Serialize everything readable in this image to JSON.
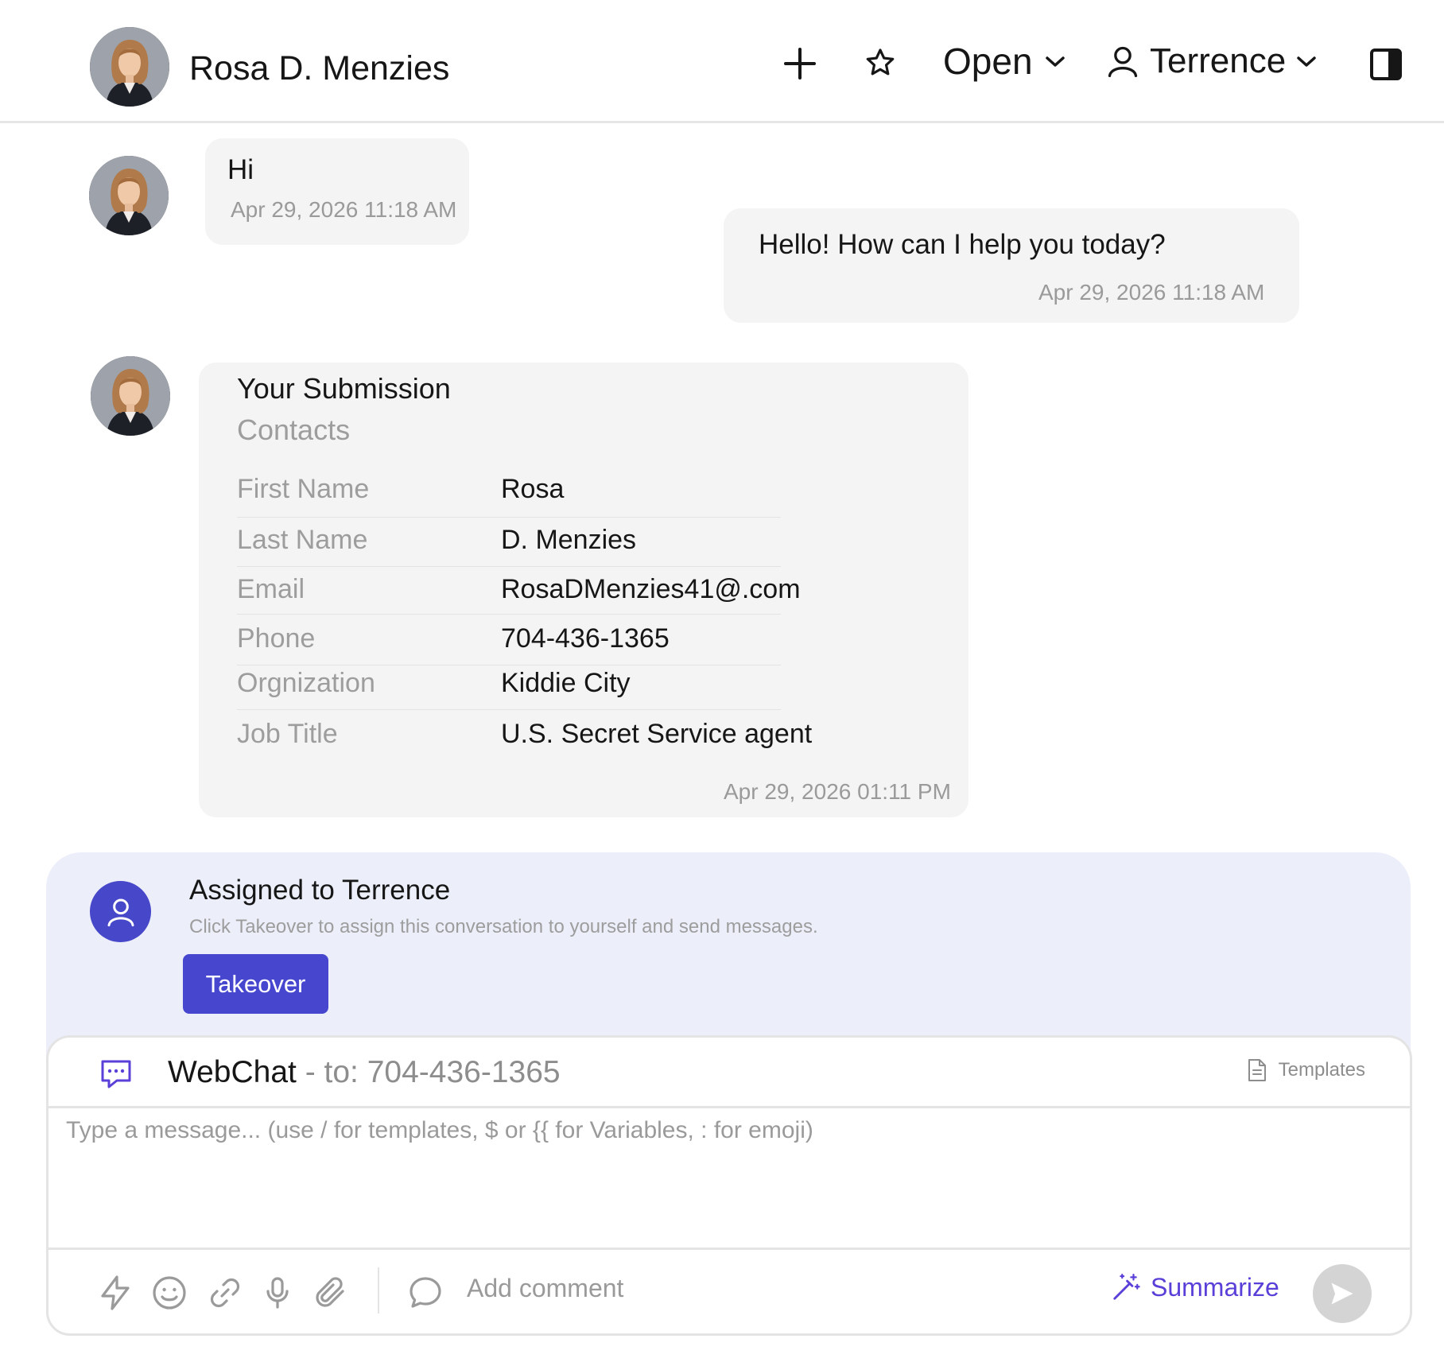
{
  "header": {
    "contact_name": "Rosa D. Menzies",
    "status": "Open",
    "assignee": "Terrence"
  },
  "messages": {
    "m1": {
      "text": "Hi",
      "time": "Apr 29, 2026 11:18 AM"
    },
    "m2": {
      "text": "Hello! How can I help you today?",
      "time": "Apr 29, 2026 11:18 AM"
    },
    "submission": {
      "title": "Your Submission",
      "subtitle": "Contacts",
      "fields": [
        {
          "label": "First Name",
          "value": "Rosa"
        },
        {
          "label": "Last Name",
          "value": "D. Menzies"
        },
        {
          "label": "Email",
          "value": "RosaDMenzies41@.com"
        },
        {
          "label": "Phone",
          "value": "704-436-1365"
        },
        {
          "label": "Orgnization",
          "value": "Kiddie City"
        },
        {
          "label": "Job Title",
          "value": "U.S. Secret Service agent"
        }
      ],
      "time": "Apr 29, 2026 01:11 PM"
    }
  },
  "assignment": {
    "title": "Assigned to Terrence",
    "description": "Click Takeover to assign this conversation to yourself and send messages.",
    "takeover_label": "Takeover"
  },
  "composer": {
    "channel": "WebChat",
    "to": " - to: 704-436-1365",
    "templates_label": "Templates",
    "placeholder": "Type a message... (use / for templates, $ or {{ for Variables, : for emoji)",
    "comment_label": "Add comment",
    "summarize_label": "Summarize"
  },
  "colors": {
    "accent": "#4646cf",
    "assign_bg": "#eceffa",
    "bubble_bg": "#f4f4f4",
    "summarize": "#5a3fd8"
  },
  "icons": [
    "plus-icon",
    "star-icon",
    "chevron-down-icon",
    "user-icon",
    "sidebar-toggle-icon",
    "chat-icon",
    "document-icon",
    "lightning-icon",
    "smiley-icon",
    "link-icon",
    "microphone-icon",
    "paperclip-icon",
    "comment-icon",
    "magic-wand-icon",
    "send-icon"
  ]
}
